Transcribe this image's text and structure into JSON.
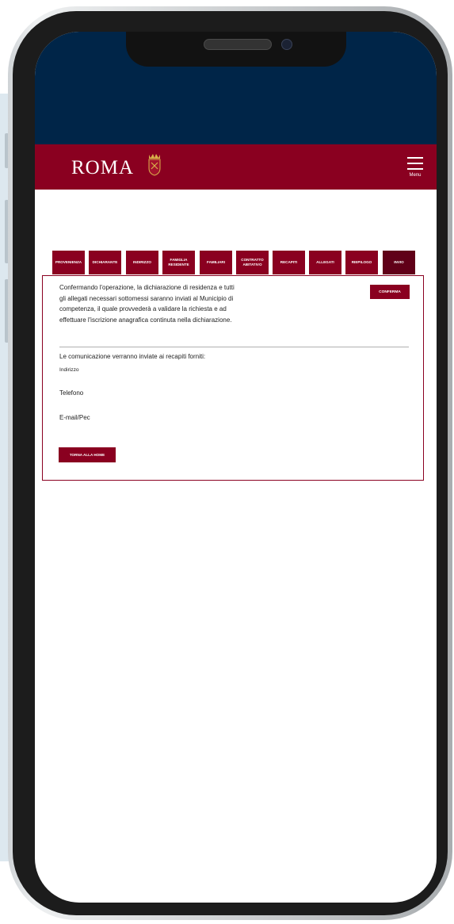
{
  "header": {
    "logo_text": "ROMA",
    "menu_label": "Menu"
  },
  "tabs": [
    {
      "label": "PROVENIENZA"
    },
    {
      "label": "DICHIARANTE"
    },
    {
      "label": "INDIRIZZO"
    },
    {
      "label": "FAMIGLIA\nRESIDENTE"
    },
    {
      "label": "FAMILIARI"
    },
    {
      "label": "CONTRATTO\nABITATIVO"
    },
    {
      "label": "RECAPITI"
    },
    {
      "label": "ALLEGATI"
    },
    {
      "label": "RIEPILOGO"
    },
    {
      "label": "INVIO",
      "active": true
    }
  ],
  "confirm": {
    "text": "Confermando l'operazione, la dichiarazione di residenza e tutti gli allegati necessari sottomessi saranno inviati al Municipio di competenza, il quale provvederà a validare la richiesta e ad effettuare l'iscrizione anagrafica continuta nella dichiarazione.",
    "button_label": "CONFERMA"
  },
  "contacts": {
    "notice": "Le comunicazione verranno inviate ai recapiti forniti:",
    "address_label": "Indirizzo",
    "phone_label": "Telefono",
    "email_label": "E-mail/Pec"
  },
  "home_button_label": "TORNA ALLA HOME",
  "colors": {
    "brand_red": "#8a0020",
    "active_tab": "#600018",
    "top_blue": "#002548"
  }
}
